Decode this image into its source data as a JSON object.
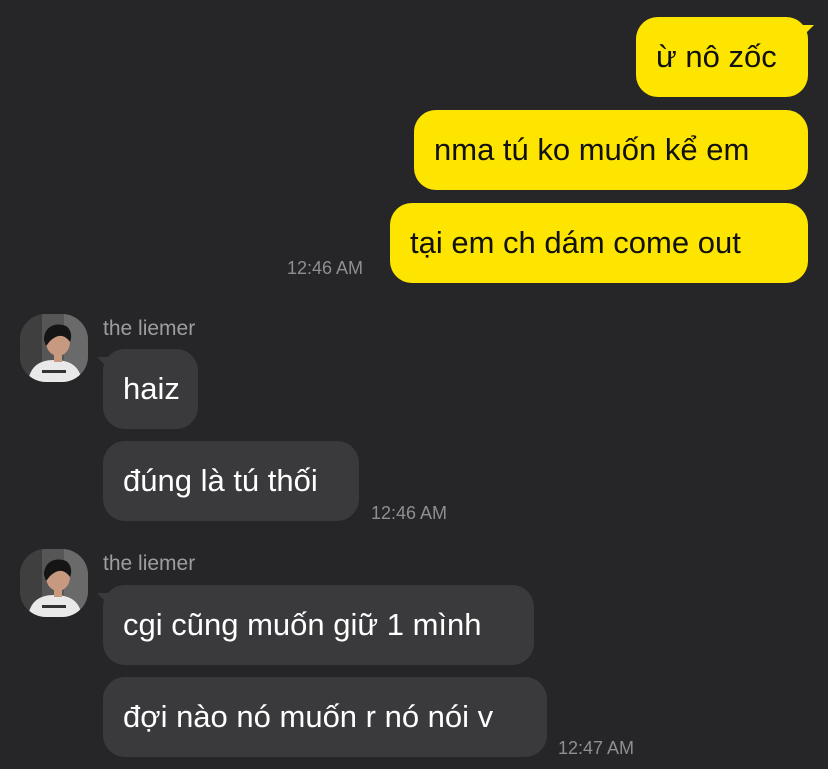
{
  "colors": {
    "background": "#262628",
    "outgoing_bubble": "#FEE500",
    "incoming_bubble": "#3a3a3c",
    "timestamp": "#8e8e93",
    "sender_name": "#9d9da1"
  },
  "outgoing_group": {
    "messages": [
      {
        "text": "ừ nô zốc"
      },
      {
        "text": "nma tú ko muốn kể em"
      },
      {
        "text": "tại em ch dám come out"
      }
    ],
    "time": "12:46 AM"
  },
  "incoming_groups": [
    {
      "sender": "the liemer",
      "avatar_icon": "profile-photo-icon",
      "messages": [
        {
          "text": "haiz"
        },
        {
          "text": "đúng là tú thối"
        }
      ],
      "time": "12:46 AM"
    },
    {
      "sender": "the liemer",
      "avatar_icon": "profile-photo-icon",
      "messages": [
        {
          "text": "cgi cũng muốn giữ 1 mình"
        },
        {
          "text": "đợi nào nó muốn r nó nói v"
        }
      ],
      "time": "12:47 AM"
    }
  ]
}
